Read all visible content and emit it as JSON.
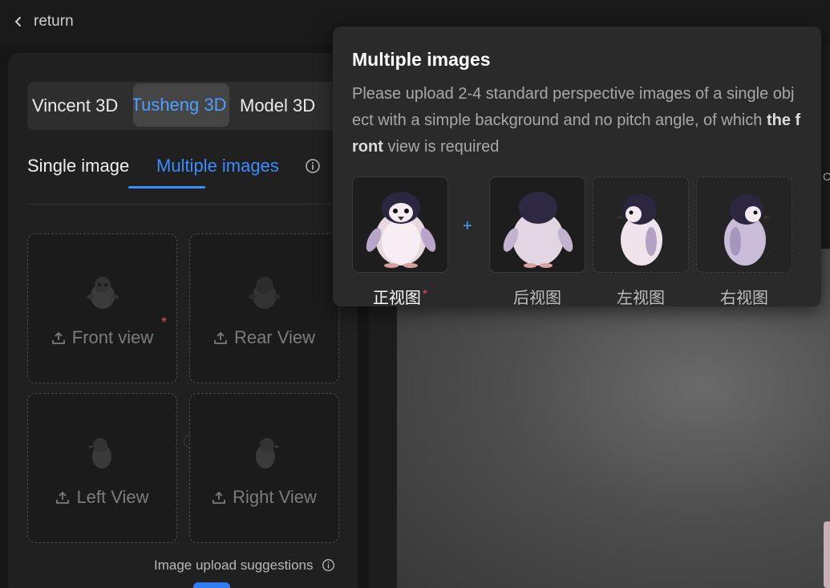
{
  "nav": {
    "return_label": "return"
  },
  "mode_tabs": [
    {
      "label": "Vincent 3D"
    },
    {
      "label": "Tusheng 3D"
    },
    {
      "label": "Model 3D"
    }
  ],
  "sub_tabs": [
    {
      "label": "Single image"
    },
    {
      "label": "Multiple images"
    }
  ],
  "upload_slots": [
    {
      "label": "Front view",
      "required": true
    },
    {
      "label": "Rear View"
    },
    {
      "label": "Left View"
    },
    {
      "label": "Right View"
    }
  ],
  "suggestions_label": "Image upload suggestions",
  "required_mark": "*",
  "popover": {
    "title": "Multiple images",
    "desc_before": "Please upload 2-4 standard perspective images of a single object with a simple background and no pitch angle, of which ",
    "desc_bold": "the front",
    "desc_after": " view is required",
    "plus": "+",
    "samples": [
      {
        "label": "正视图"
      },
      {
        "label": "后视图"
      },
      {
        "label": "左视图"
      },
      {
        "label": "右视图"
      }
    ]
  },
  "edge_text": "C",
  "colors": {
    "accent": "#3b8cff",
    "required": "#e25050",
    "background": "#161616"
  }
}
